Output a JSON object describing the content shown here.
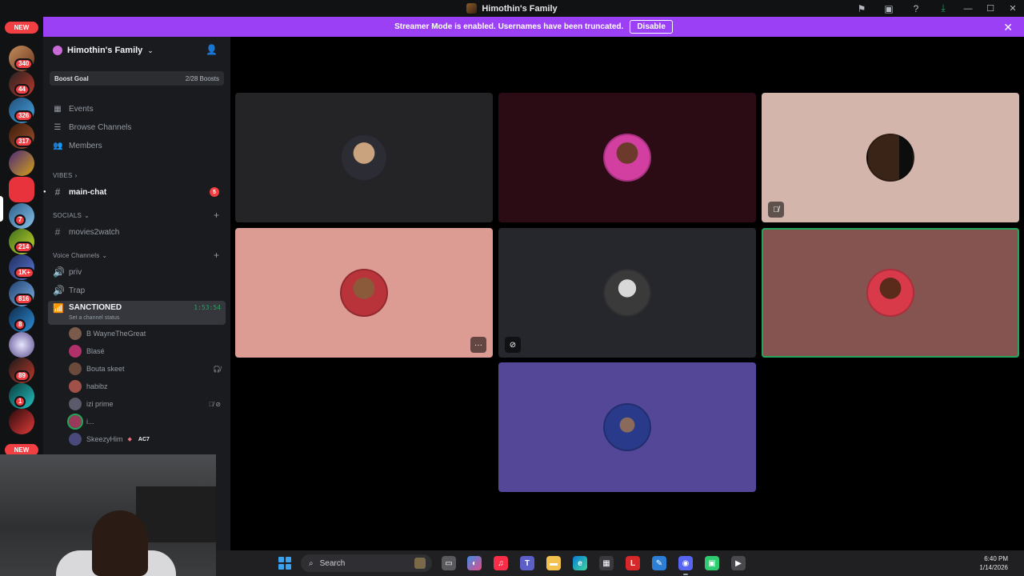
{
  "window": {
    "title": "Himothin's Family"
  },
  "banner": {
    "message": "Streamer Mode is enabled. Usernames have been truncated.",
    "button": "Disable"
  },
  "rail": {
    "new_top": "NEW",
    "new_bottom": "NEW",
    "badges": [
      "340",
      "44",
      "326",
      "317",
      "7",
      "214",
      "1K+",
      "816",
      "8",
      "89",
      "1"
    ]
  },
  "server": {
    "name": "Himothin's Family",
    "boost_label": "Boost Goal",
    "boost_value": "2/28 Boosts"
  },
  "nav": {
    "events": "Events",
    "browse": "Browse Channels",
    "members": "Members"
  },
  "categories": {
    "vibes": "VIBES",
    "socials": "SOCIALS",
    "voice": "Voice Channels"
  },
  "channels": {
    "main_chat": "main-chat",
    "main_chat_mentions": "5",
    "movies": "movies2watch",
    "priv": "priv",
    "trap": "Trap",
    "sanctioned": "SANCTIONED",
    "sanctioned_time": "1:53:54",
    "sanctioned_status": "Set a channel status"
  },
  "members": [
    {
      "name": "B WayneTheGreat",
      "tags": ""
    },
    {
      "name": "Blasé",
      "tags": ""
    },
    {
      "name": "Bouta skeet",
      "tags": "deafened"
    },
    {
      "name": "habibz",
      "tags": ""
    },
    {
      "name": "izi prime",
      "tags": "muted, video-off"
    },
    {
      "name": "i...",
      "tags": ""
    },
    {
      "name": "SkeezyHim",
      "tags": "AC7"
    }
  ],
  "member_ac7": "AC7",
  "taskbar": {
    "search": "Search",
    "time": "6:40 PM",
    "date": "1/14/2026"
  },
  "colors": {
    "accent": "#9b40f5",
    "speaking": "#23a55a",
    "mention": "#f23f43"
  }
}
